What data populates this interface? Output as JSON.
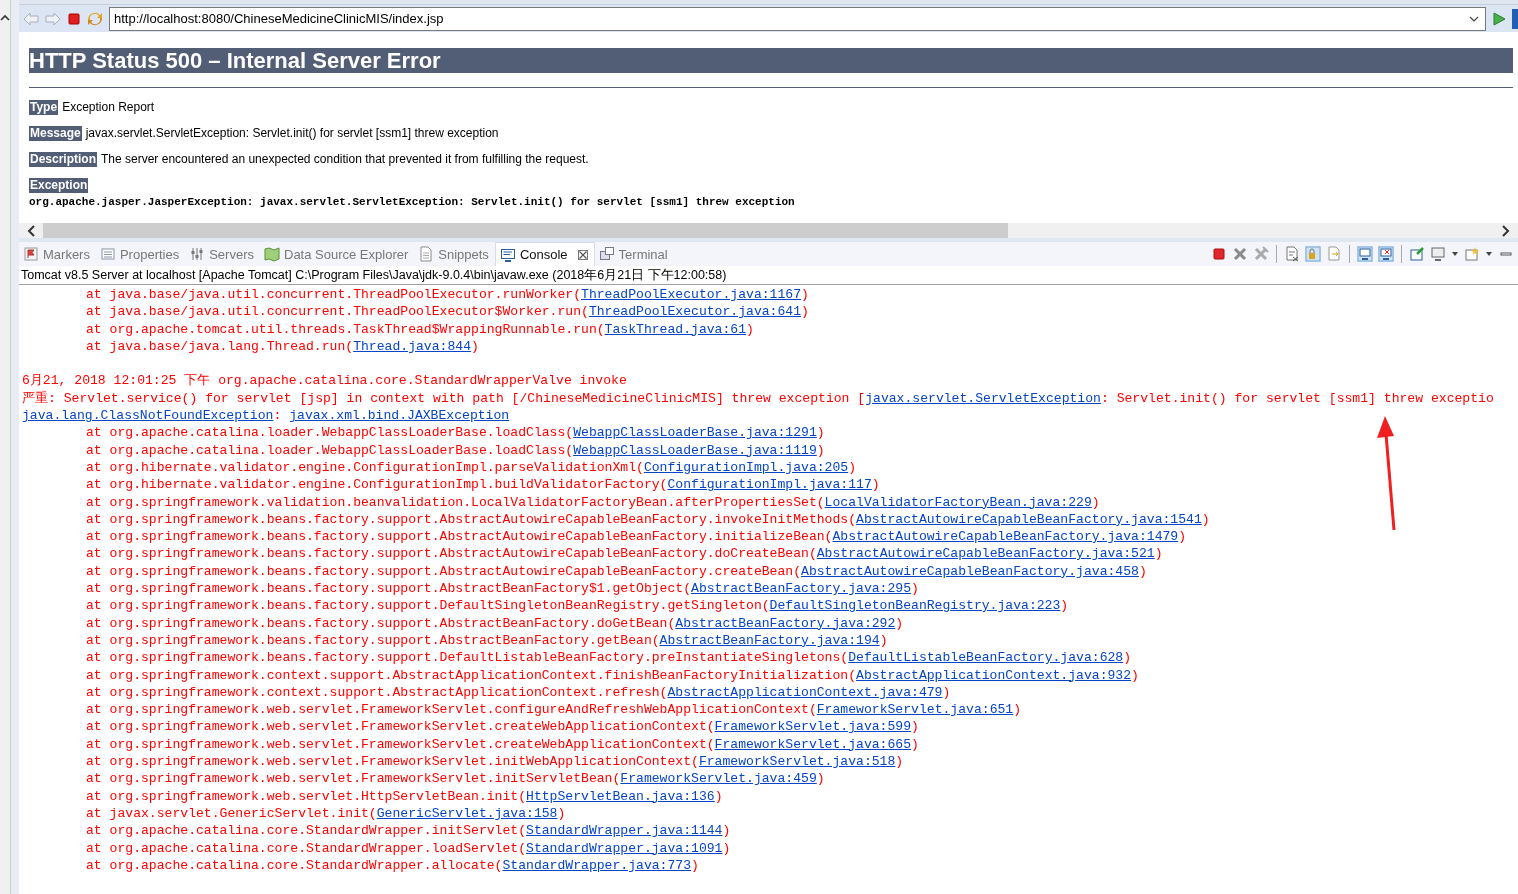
{
  "browser": {
    "url": "http://localhost:8080/ChineseMedicineClinicMIS/index.jsp",
    "heading": "HTTP Status 500 – Internal Server Error",
    "fields": [
      {
        "label": "Type",
        "value": "Exception Report"
      },
      {
        "label": "Message",
        "value": "javax.servlet.ServletException: Servlet.init() for servlet [ssm1] threw exception"
      },
      {
        "label": "Description",
        "value": "The server encountered an unexpected condition that prevented it from fulfilling the request."
      },
      {
        "label": "Exception"
      }
    ],
    "exception_text": "org.apache.jasper.JasperException: javax.servlet.ServletException: Servlet.init() for servlet [ssm1] threw exception"
  },
  "views": {
    "tabs": [
      {
        "label": "Markers",
        "selected": false
      },
      {
        "label": "Properties",
        "selected": false
      },
      {
        "label": "Servers",
        "selected": false
      },
      {
        "label": "Data Source Explorer",
        "selected": false
      },
      {
        "label": "Snippets",
        "selected": false
      },
      {
        "label": "Console",
        "selected": true
      },
      {
        "label": "Terminal",
        "selected": false
      }
    ]
  },
  "console": {
    "process": "Tomcat v8.5 Server at localhost [Apache Tomcat] C:\\Program Files\\Java\\jdk-9.0.4\\bin\\javaw.exe (2018年6月21日 下午12:00:58)",
    "lines": [
      {
        "kind": "frame",
        "call": "at java.base/java.util.concurrent.ThreadPoolExecutor.runWorker(",
        "source": "ThreadPoolExecutor.java:1167",
        "close": ")"
      },
      {
        "kind": "frame",
        "call": "at java.base/java.util.concurrent.ThreadPoolExecutor$Worker.run(",
        "source": "ThreadPoolExecutor.java:641",
        "close": ")"
      },
      {
        "kind": "frame",
        "call": "at org.apache.tomcat.util.threads.TaskThread$WrappingRunnable.run(",
        "source": "TaskThread.java:61",
        "close": ")"
      },
      {
        "kind": "frame",
        "call": "at java.base/java.lang.Thread.run(",
        "source": "Thread.java:844",
        "close": ")"
      },
      {
        "kind": "gap"
      },
      {
        "kind": "text",
        "parts": [
          {
            "text": "6月21, 2018 12:01:25 下午 org.apache.catalina.core.StandardWrapperValve invoke",
            "link": false
          }
        ]
      },
      {
        "kind": "text",
        "parts": [
          {
            "text": "严重: Servlet.service() for servlet [jsp] in context with path [/ChineseMedicineClinicMIS] threw exception [",
            "link": false
          },
          {
            "text": "javax.servlet.ServletException",
            "link": true
          },
          {
            "text": ": Servlet.init() for servlet [ssm1] threw exceptio",
            "link": false
          }
        ]
      },
      {
        "kind": "text",
        "parts": [
          {
            "text": "java.lang.ClassNotFoundException",
            "link": true
          },
          {
            "text": ": ",
            "link": false
          },
          {
            "text": "javax.xml.bind.JAXBException",
            "link": true
          }
        ]
      },
      {
        "kind": "frame",
        "call": "at org.apache.catalina.loader.WebappClassLoaderBase.loadClass(",
        "source": "WebappClassLoaderBase.java:1291",
        "close": ")"
      },
      {
        "kind": "frame",
        "call": "at org.apache.catalina.loader.WebappClassLoaderBase.loadClass(",
        "source": "WebappClassLoaderBase.java:1119",
        "close": ")"
      },
      {
        "kind": "frame",
        "call": "at org.hibernate.validator.engine.ConfigurationImpl.parseValidationXml(",
        "source": "ConfigurationImpl.java:205",
        "close": ")"
      },
      {
        "kind": "frame",
        "call": "at org.hibernate.validator.engine.ConfigurationImpl.buildValidatorFactory(",
        "source": "ConfigurationImpl.java:117",
        "close": ")"
      },
      {
        "kind": "frame",
        "call": "at org.springframework.validation.beanvalidation.LocalValidatorFactoryBean.afterPropertiesSet(",
        "source": "LocalValidatorFactoryBean.java:229",
        "close": ")"
      },
      {
        "kind": "frame",
        "call": "at org.springframework.beans.factory.support.AbstractAutowireCapableBeanFactory.invokeInitMethods(",
        "source": "AbstractAutowireCapableBeanFactory.java:1541",
        "close": ")"
      },
      {
        "kind": "frame",
        "call": "at org.springframework.beans.factory.support.AbstractAutowireCapableBeanFactory.initializeBean(",
        "source": "AbstractAutowireCapableBeanFactory.java:1479",
        "close": ")"
      },
      {
        "kind": "frame",
        "call": "at org.springframework.beans.factory.support.AbstractAutowireCapableBeanFactory.doCreateBean(",
        "source": "AbstractAutowireCapableBeanFactory.java:521",
        "close": ")"
      },
      {
        "kind": "frame",
        "call": "at org.springframework.beans.factory.support.AbstractAutowireCapableBeanFactory.createBean(",
        "source": "AbstractAutowireCapableBeanFactory.java:458",
        "close": ")"
      },
      {
        "kind": "frame",
        "call": "at org.springframework.beans.factory.support.AbstractBeanFactory$1.getObject(",
        "source": "AbstractBeanFactory.java:295",
        "close": ")"
      },
      {
        "kind": "frame",
        "call": "at org.springframework.beans.factory.support.DefaultSingletonBeanRegistry.getSingleton(",
        "source": "DefaultSingletonBeanRegistry.java:223",
        "close": ")"
      },
      {
        "kind": "frame",
        "call": "at org.springframework.beans.factory.support.AbstractBeanFactory.doGetBean(",
        "source": "AbstractBeanFactory.java:292",
        "close": ")"
      },
      {
        "kind": "frame",
        "call": "at org.springframework.beans.factory.support.AbstractBeanFactory.getBean(",
        "source": "AbstractBeanFactory.java:194",
        "close": ")"
      },
      {
        "kind": "frame",
        "call": "at org.springframework.beans.factory.support.DefaultListableBeanFactory.preInstantiateSingletons(",
        "source": "DefaultListableBeanFactory.java:628",
        "close": ")"
      },
      {
        "kind": "frame",
        "call": "at org.springframework.context.support.AbstractApplicationContext.finishBeanFactoryInitialization(",
        "source": "AbstractApplicationContext.java:932",
        "close": ")"
      },
      {
        "kind": "frame",
        "call": "at org.springframework.context.support.AbstractApplicationContext.refresh(",
        "source": "AbstractApplicationContext.java:479",
        "close": ")"
      },
      {
        "kind": "frame",
        "call": "at org.springframework.web.servlet.FrameworkServlet.configureAndRefreshWebApplicationContext(",
        "source": "FrameworkServlet.java:651",
        "close": ")"
      },
      {
        "kind": "frame",
        "call": "at org.springframework.web.servlet.FrameworkServlet.createWebApplicationContext(",
        "source": "FrameworkServlet.java:599",
        "close": ")"
      },
      {
        "kind": "frame",
        "call": "at org.springframework.web.servlet.FrameworkServlet.createWebApplicationContext(",
        "source": "FrameworkServlet.java:665",
        "close": ")"
      },
      {
        "kind": "frame",
        "call": "at org.springframework.web.servlet.FrameworkServlet.initWebApplicationContext(",
        "source": "FrameworkServlet.java:518",
        "close": ")"
      },
      {
        "kind": "frame",
        "call": "at org.springframework.web.servlet.FrameworkServlet.initServletBean(",
        "source": "FrameworkServlet.java:459",
        "close": ")"
      },
      {
        "kind": "frame",
        "call": "at org.springframework.web.servlet.HttpServletBean.init(",
        "source": "HttpServletBean.java:136",
        "close": ")"
      },
      {
        "kind": "frame",
        "call": "at javax.servlet.GenericServlet.init(",
        "source": "GenericServlet.java:158",
        "close": ")"
      },
      {
        "kind": "frame",
        "call": "at org.apache.catalina.core.StandardWrapper.initServlet(",
        "source": "StandardWrapper.java:1144",
        "close": ")"
      },
      {
        "kind": "frame",
        "call": "at org.apache.catalina.core.StandardWrapper.loadServlet(",
        "source": "StandardWrapper.java:1091",
        "close": ")"
      },
      {
        "kind": "frame",
        "call": "at org.apache.catalina.core.StandardWrapper.allocate(",
        "source": "StandardWrapper.java:773",
        "close": ")"
      }
    ]
  }
}
